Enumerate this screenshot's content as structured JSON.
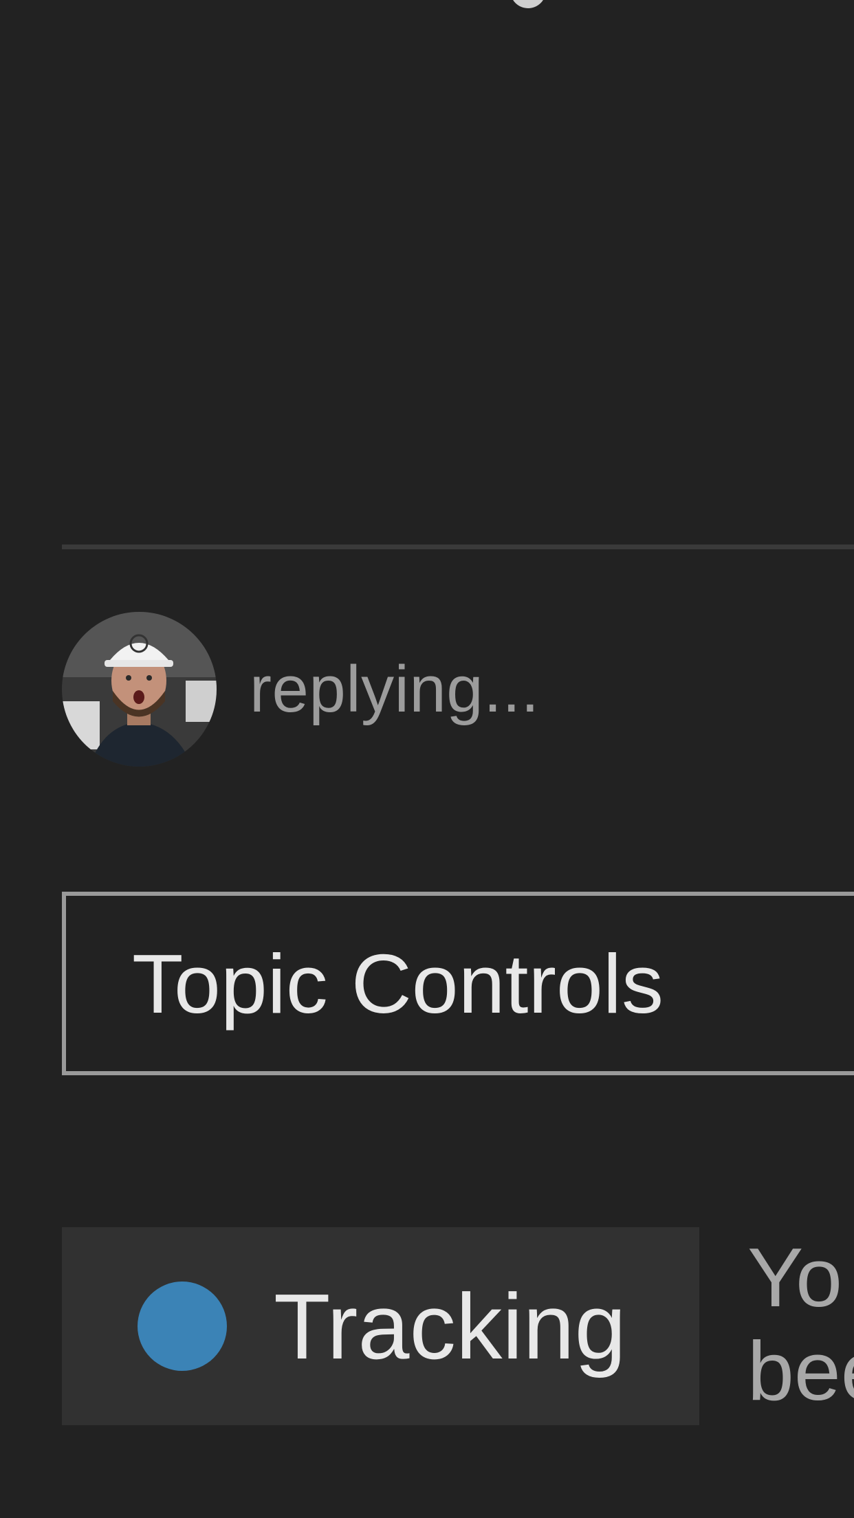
{
  "reply_status": {
    "text": "replying..."
  },
  "topic_controls": {
    "label": "Topic Controls"
  },
  "notification_level": {
    "label": "Tracking",
    "color": "#3b83b6",
    "description_line1": "Yo",
    "description_line2": "bee"
  },
  "colors": {
    "background": "#222222",
    "divider": "#3a3a3a",
    "button_background": "#313131",
    "border": "#9a9a9a"
  },
  "icons": {
    "avatar": "user-avatar",
    "tracking_indicator": "circle-indicator-icon"
  }
}
